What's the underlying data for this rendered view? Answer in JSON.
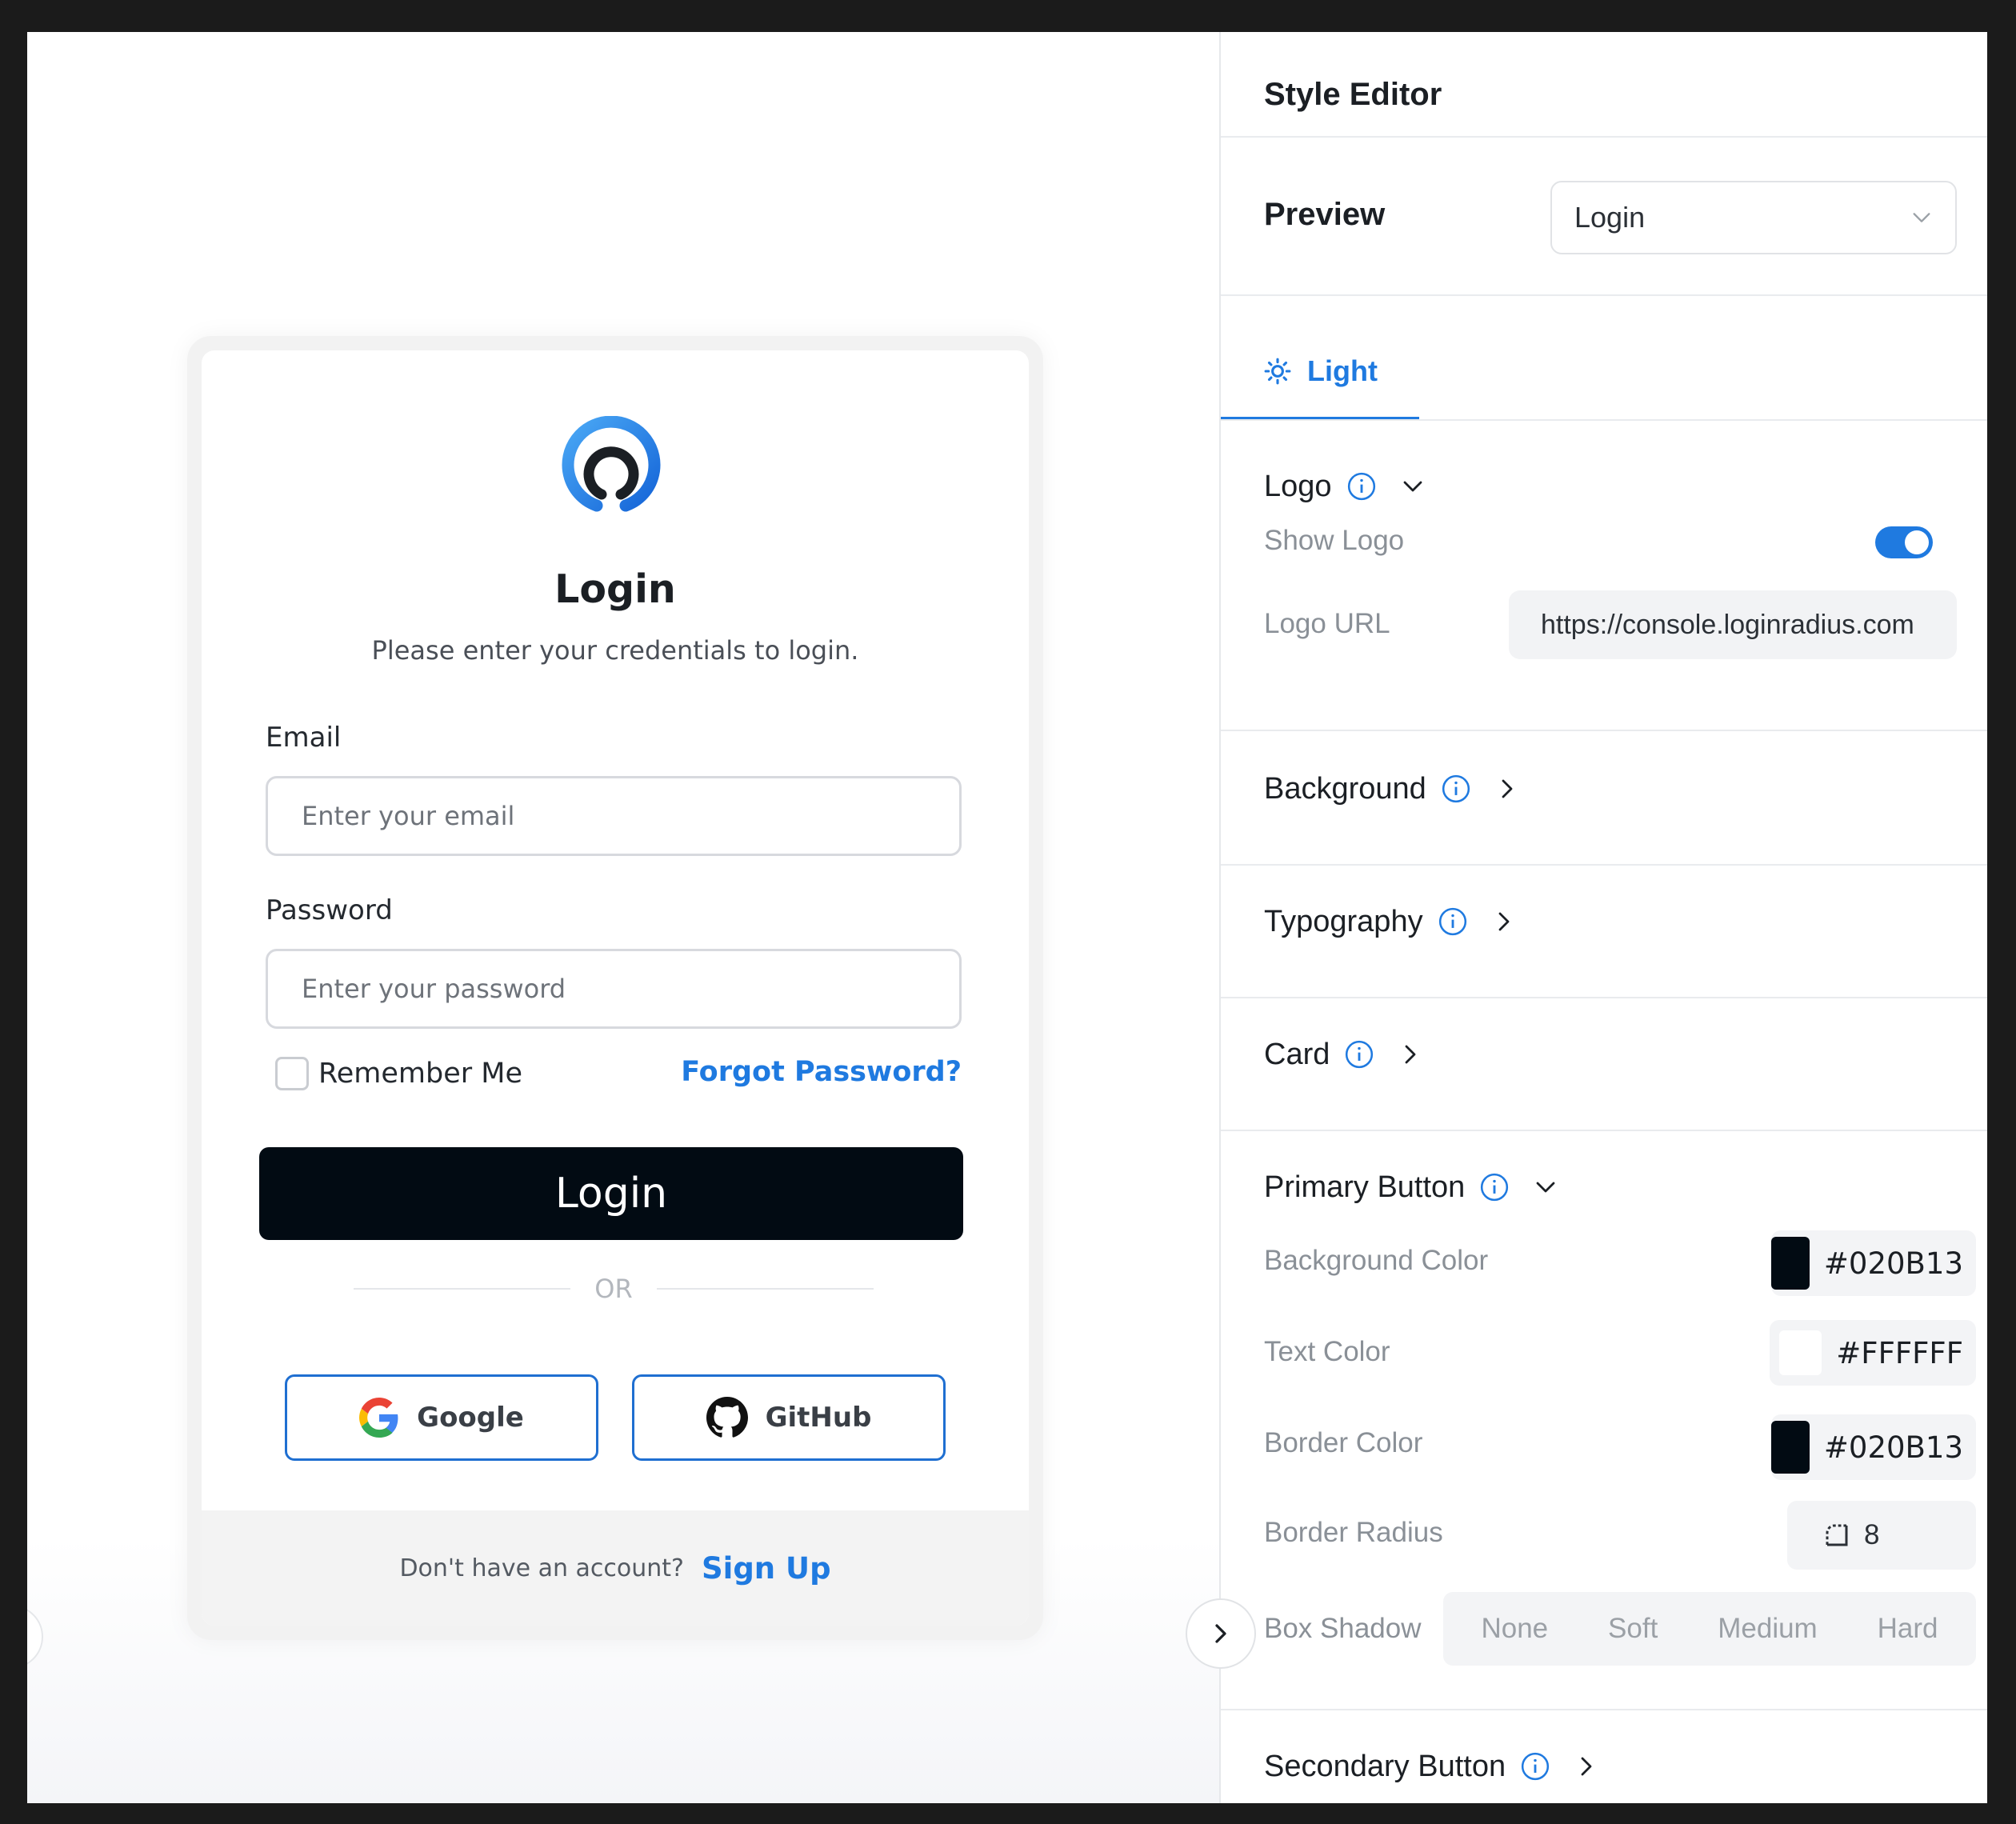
{
  "preview": {
    "card": {
      "title": "Login",
      "subtitle": "Please enter your credentials to login.",
      "email_label": "Email",
      "email_placeholder": "Enter your email",
      "password_label": "Password",
      "password_placeholder": "Enter your password",
      "remember_me": "Remember Me",
      "forgot_password": "Forgot Password?",
      "login_button": "Login",
      "or_text": "OR",
      "google_label": "Google",
      "github_label": "GitHub",
      "footer_text": "Don't have an account?",
      "signup_link": "Sign Up"
    }
  },
  "panel": {
    "title": "Style Editor",
    "preview_label": "Preview",
    "preview_select_value": "Login",
    "tab_light": "Light",
    "logo_section": "Logo",
    "show_logo_label": "Show Logo",
    "show_logo_enabled": true,
    "logo_url_label": "Logo URL",
    "logo_url_value": "https://console.loginradius.com",
    "background_section": "Background",
    "typography_section": "Typography",
    "card_section": "Card",
    "primary_button_section": "Primary Button",
    "bg_color_label": "Background Color",
    "bg_color_value": "#020B13",
    "text_color_label": "Text Color",
    "text_color_value": "#FFFFFF",
    "border_color_label": "Border Color",
    "border_color_value": "#020B13",
    "border_radius_label": "Border Radius",
    "border_radius_value": "8",
    "box_shadow_label": "Box Shadow",
    "box_shadow_options": [
      "None",
      "Soft",
      "Medium",
      "Hard"
    ],
    "secondary_button_section": "Secondary Button"
  },
  "colors": {
    "accent": "#1F7AE0",
    "primary_button_bg": "#020B13",
    "primary_button_text": "#FFFFFF"
  },
  "icons": [
    "app-logo-icon",
    "google-icon",
    "github-icon",
    "sun-icon",
    "info-icon",
    "chevron-down-icon",
    "chevron-right-icon",
    "border-radius-icon"
  ]
}
